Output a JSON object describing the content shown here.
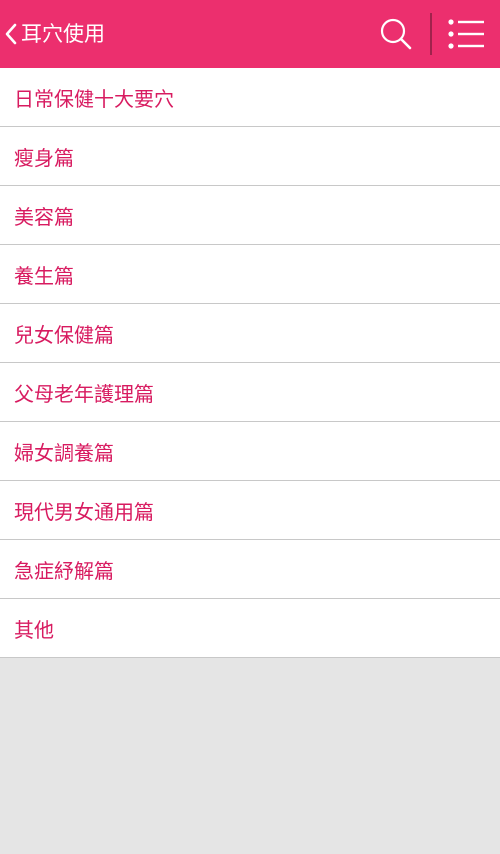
{
  "header": {
    "title": "耳穴使用",
    "icons": {
      "back": "chevron-left-icon",
      "search": "search-icon",
      "menu": "list-menu-icon"
    },
    "background": "#ec2f6e"
  },
  "list": {
    "text_color": "#d81b60",
    "items": [
      {
        "label": "日常保健十大要穴"
      },
      {
        "label": "瘦身篇"
      },
      {
        "label": "美容篇"
      },
      {
        "label": "養生篇"
      },
      {
        "label": "兒女保健篇"
      },
      {
        "label": "父母老年護理篇"
      },
      {
        "label": "婦女調養篇"
      },
      {
        "label": "現代男女通用篇"
      },
      {
        "label": "急症紓解篇"
      },
      {
        "label": "其他"
      }
    ]
  }
}
